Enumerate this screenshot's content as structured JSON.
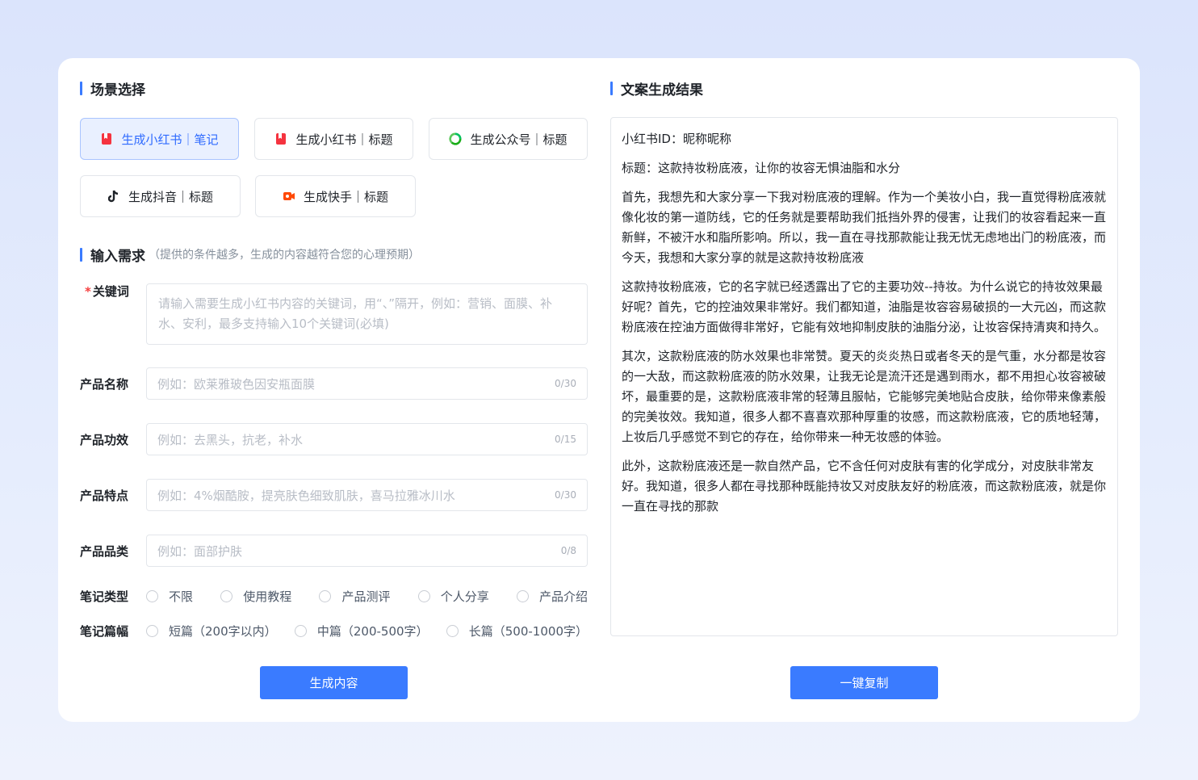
{
  "scene": {
    "title": "场景选择",
    "buttons": [
      {
        "label": "生成小红书｜笔记",
        "active": true
      },
      {
        "label": "生成小红书｜标题",
        "active": false
      },
      {
        "label": "生成公众号｜标题",
        "active": false
      },
      {
        "label": "生成抖音｜标题",
        "active": false
      },
      {
        "label": "生成快手｜标题",
        "active": false
      }
    ]
  },
  "input": {
    "title": "输入需求",
    "hint": "（提供的条件越多，生成的内容越符合您的心理预期）",
    "keyword": {
      "required_mark": "*",
      "label": "关键词",
      "placeholder": "请输入需要生成小红书内容的关键词，用“、”隔开，例如：营销、面膜、补水、安利，最多支持输入10个关键词(必填)"
    },
    "product_name": {
      "label": "产品名称",
      "placeholder": "例如：欧莱雅玻色因安瓶面膜",
      "count": "0/30"
    },
    "product_effect": {
      "label": "产品功效",
      "placeholder": "例如：去黑头，抗老，补水",
      "count": "0/15"
    },
    "product_feature": {
      "label": "产品特点",
      "placeholder": "例如：4%烟酷胺，提亮肤色细致肌肤，喜马拉雅冰川水",
      "count": "0/30"
    },
    "product_category": {
      "label": "产品品类",
      "placeholder": "例如：面部护肤",
      "count": "0/8"
    },
    "note_type": {
      "label": "笔记类型",
      "options": [
        "不限",
        "使用教程",
        "产品测评",
        "个人分享",
        "产品介绍"
      ]
    },
    "note_length": {
      "label": "笔记篇幅",
      "options": [
        "短篇（200字以内）",
        "中篇（200-500字）",
        "长篇（500-1000字）"
      ]
    },
    "generate_label": "生成内容"
  },
  "result": {
    "title": "文案生成结果",
    "paragraphs": [
      "小红书ID：昵称昵称",
      "标题：这款持妆粉底液，让你的妆容无惧油脂和水分",
      "首先，我想先和大家分享一下我对粉底液的理解。作为一个美妆小白，我一直觉得粉底液就像化妆的第一道防线，它的任务就是要帮助我们抵挡外界的侵害，让我们的妆容看起来一直新鲜，不被汗水和脂所影响。所以，我一直在寻找那款能让我无忧无虑地出门的粉底液，而今天，我想和大家分享的就是这款持妆粉底液",
      "这款持妆粉底液，它的名字就已经透露出了它的主要功效--持妆。为什么说它的持妆效果最好呢？首先，它的控油效果非常好。我们都知道，油脂是妆容容易破损的一大元凶，而这款粉底液在控油方面做得非常好，它能有效地抑制皮肤的油脂分泌，让妆容保持清爽和持久。",
      "其次，这款粉底液的防水效果也非常赞。夏天的炎炎热日或者冬天的是气重，水分都是妆容的一大敌，而这款粉底液的防水效果，让我无论是流汗还是遇到雨水，都不用担心妆容被破坏，最重要的是，这款粉底液非常的轻薄且服帖，它能够完美地贴合皮肤，给你带来像素般的完美妆效。我知道，很多人都不喜喜欢那种厚重的妆感，而这款粉底液，它的质地轻薄，上妆后几乎感觉不到它的存在，给你带来一种无妆感的体验。",
      "此外，这款粉底液还是一款自然产品，它不含任何对皮肤有害的化学成分，对皮肤非常友好。我知道，很多人都在寻找那种既能持妆又对皮肤友好的粉底液，而这款粉底液，就是你一直在寻找的那款"
    ],
    "copy_label": "一键复制"
  },
  "icons": {
    "xiaohongshu": "xiaohongshu-icon",
    "wechat": "wechat-official-icon",
    "douyin": "douyin-icon",
    "kuaishou": "kuaishou-icon"
  },
  "colors": {
    "accent": "#3a7bff",
    "xiaohongshu": "#f5333f",
    "wechat": "#07c160",
    "kuaishou": "#ff4906",
    "active_bg": "#e9f0ff"
  }
}
